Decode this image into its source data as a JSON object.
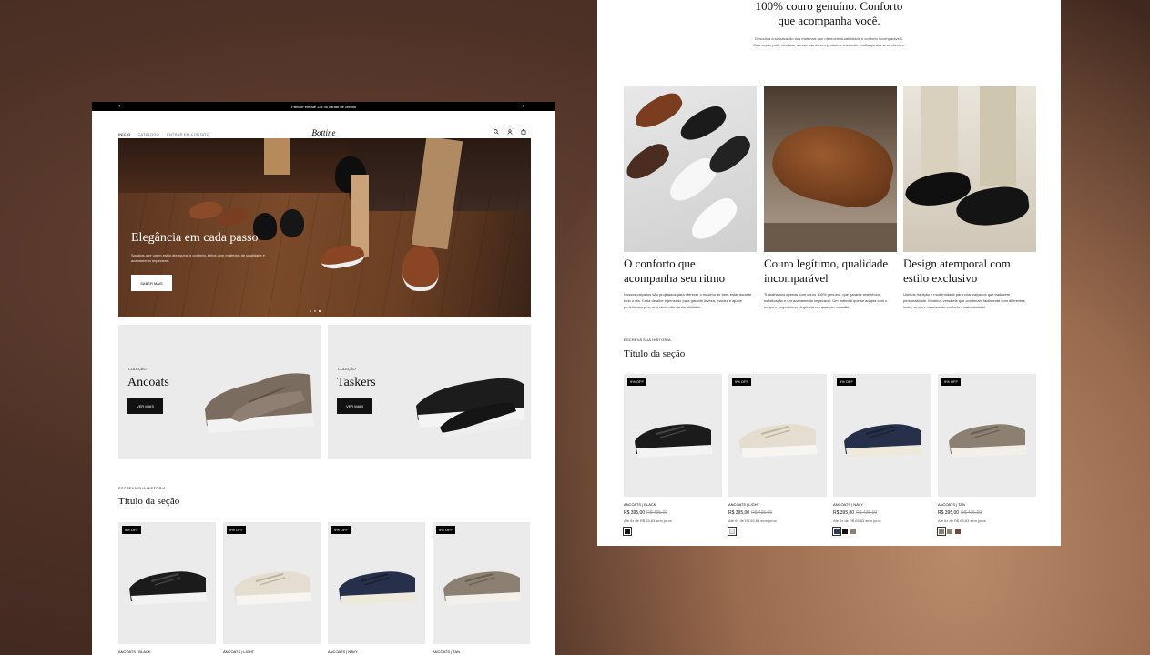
{
  "left": {
    "announcement": "Parcele em até 12x no cartão de crédito",
    "nav_links": [
      "INÍCIO",
      "CATÁLOGO",
      "ENTRAR EM CONTATO"
    ],
    "logo": "Bottine",
    "hero": {
      "title": "Elegância em cada passo",
      "subtitle": "Sapatos que unem estilo atemporal e conforto, feitos com materiais de qualidade e acabamento impecável.",
      "button": "SABER MAIS"
    },
    "collections": [
      {
        "label": "COLEÇÃO",
        "title": "Ancoats",
        "button": "VER MAIS"
      },
      {
        "label": "COLEÇÃO",
        "title": "Taskers",
        "button": "VER MAIS"
      }
    ],
    "section_label": "ESCREVA SUA HISTÓRIA",
    "section_title": "Título da seção",
    "products": [
      {
        "badge": "9% OFF",
        "name": "ANCOATS | BLACK"
      },
      {
        "badge": "9% OFF",
        "name": "ANCOATS | LIGHT"
      },
      {
        "badge": "9% OFF",
        "name": "ANCOATS | NAVY"
      },
      {
        "badge": "9% OFF",
        "name": "ANCOATS | TAN"
      }
    ]
  },
  "right": {
    "heading_line1": "100% couro genuíno. Conforto",
    "heading_line2": "que acompanha você.",
    "intro_line1": "Descubra a sofisticação dos materiais que oferecem durabilidade e conforto incomparáveis.",
    "intro_line2": "Esta seção pode destacar a essência do seu produto e transmitir confiança aos seus clientes.",
    "features": [
      {
        "title": "O conforto que acompanha seu ritmo",
        "text": "Nossos calçados são projetados para oferecer o máximo de bem-estar durante todo o dia. Cada detalhe é pensado para garantir leveza, maciez e ajuste perfeito aos pés, sem abrir mão da durabilidade."
      },
      {
        "title": "Couro legítimo, qualidade incomparável",
        "text": "Trabalhamos apenas com couro 100% genuíno, que garante resistência, sofisticação e um acabamento impecável. Um material que se adapta com o tempo e proporciona elegância em qualquer ocasião."
      },
      {
        "title": "Design atemporal com estilo exclusivo",
        "text": "Unimos tradição e modernidade para criar calçados que traduzem personalidade. Modelos versáteis que combinam facilmente com diferentes looks, sempre valorizando conforto e autenticidade."
      }
    ],
    "section_label": "ESCREVA SUA HISTÓRIA",
    "section_title": "Título da seção",
    "products": [
      {
        "badge": "9% OFF",
        "name": "ANCOATS | BLACK",
        "price": "R$ 395,00",
        "old_price": "R$ 435,00",
        "installments": "Até 6x de R$ 65,83 sem juros"
      },
      {
        "badge": "9% OFF",
        "name": "ANCOATS | LIGHT",
        "price": "R$ 395,00",
        "old_price": "R$ 435,00",
        "installments": "Até 6x de R$ 65,83 sem juros"
      },
      {
        "badge": "9% OFF",
        "name": "ANCOATS | NAVY",
        "price": "R$ 395,00",
        "old_price": "R$ 435,00",
        "installments": "Até 6x de R$ 65,83 sem juros"
      },
      {
        "badge": "9% OFF",
        "name": "ANCOATS | TAN",
        "price": "R$ 395,00",
        "old_price": "R$ 435,00",
        "installments": "Até 6x de R$ 65,83 sem juros"
      }
    ]
  },
  "colors": {
    "background": "#4e3126",
    "accent_black": "#000000",
    "card_gray": "#ebebeb",
    "swatch_black": "#111111",
    "swatch_light": "#e9e4da",
    "swatch_navy": "#2f3a55",
    "swatch_tan": "#8c8072",
    "swatch_brown": "#6e4a3e"
  }
}
